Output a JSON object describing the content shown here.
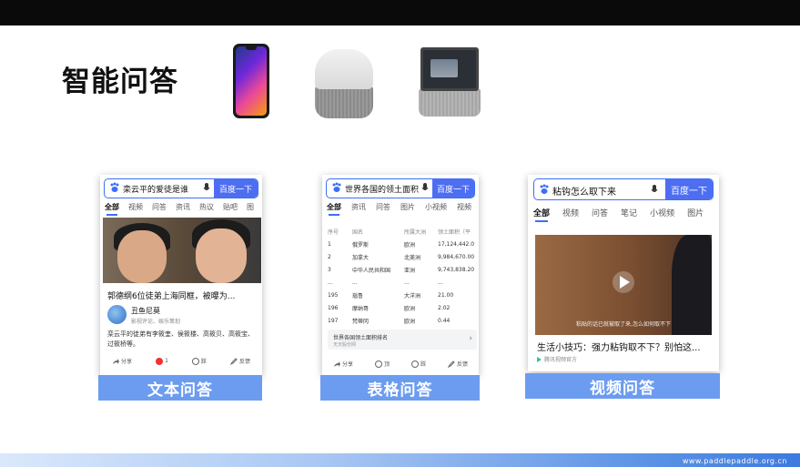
{
  "slide": {
    "title": "智能问答",
    "footer_url": "www.paddlepaddle.org.cn"
  },
  "devices": [
    "phone-icon",
    "smart-speaker-icon",
    "smart-display-icon"
  ],
  "colors": {
    "accent": "#4e6ef2",
    "label_bg": "#6c9cf0"
  },
  "text_qa": {
    "label": "文本问答",
    "query": "栾云平的爱徒是谁",
    "search_button": "百度一下",
    "tabs": [
      "全部",
      "视频",
      "问答",
      "资讯",
      "热议",
      "贴吧",
      "图"
    ],
    "headline": "郭德纲6位徒弟上海同框，被曝为...",
    "author": "丑鱼尼莫",
    "author_desc": "影视评论、娱乐策划",
    "snippet": "栾云平的徒弟有李筱奎、侯筱楼、高筱贝、高筱宝、过筱桥等。",
    "actions": [
      "分享",
      "1",
      "踩",
      "反馈"
    ]
  },
  "table_qa": {
    "label": "表格问答",
    "query": "世界各国的领土面积",
    "search_button": "百度一下",
    "tabs": [
      "全部",
      "资讯",
      "问答",
      "图片",
      "小视频",
      "视频"
    ],
    "table": {
      "headers": [
        "序号",
        "国名",
        "所属大洲",
        "领土面积（平"
      ],
      "rows": [
        [
          "1",
          "俄罗斯",
          "欧洲",
          "17,124,442.0"
        ],
        [
          "2",
          "加拿大",
          "北美洲",
          "9,984,670.00"
        ],
        [
          "3",
          "中华人民共和国",
          "亚洲",
          "9,743,838.20"
        ],
        [
          "...",
          "...",
          "...",
          "..."
        ],
        [
          "195",
          "瑙鲁",
          "大洋洲",
          "21.00"
        ],
        [
          "196",
          "摩纳哥",
          "欧洲",
          "2.02"
        ],
        [
          "197",
          "梵蒂冈",
          "欧洲",
          "0.44"
        ]
      ]
    },
    "link_title": "世界各国领土面积排名",
    "link_sub": "天天股份网",
    "actions": [
      "分享",
      "顶",
      "踩",
      "反馈"
    ]
  },
  "video_qa": {
    "label": "视频问答",
    "query": "粘钩怎么取下来",
    "search_button": "百度一下",
    "tabs": [
      "全部",
      "视频",
      "问答",
      "笔记",
      "小视频",
      "图片"
    ],
    "subtitle": "粘贴的话已就被取了来,怎么如何取不下",
    "headline": "生活小技巧：强力粘钩取不下？别怕这...",
    "source": "腾讯视频官方"
  }
}
